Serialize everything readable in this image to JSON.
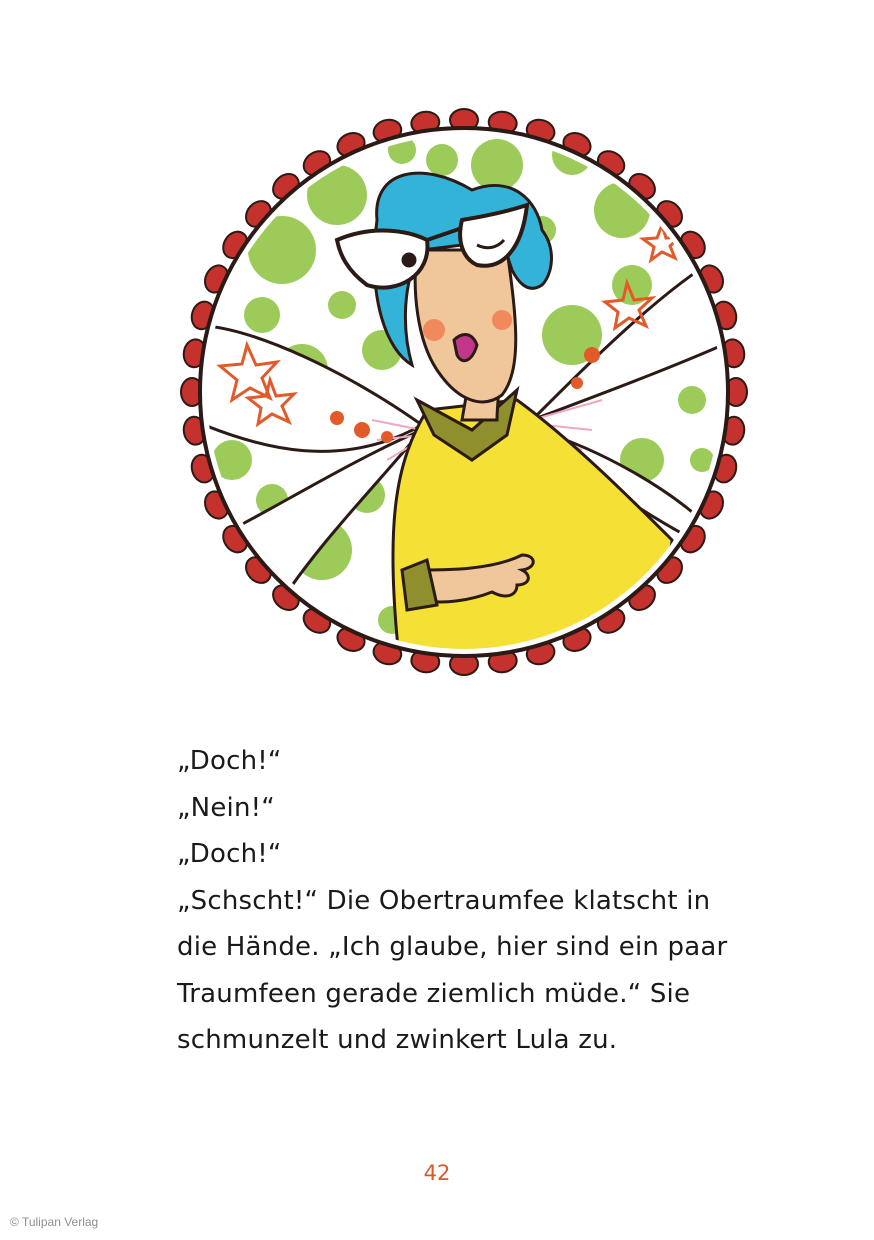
{
  "page": {
    "lines": [
      "„Doch!“",
      "„Nein!“",
      "„Doch!“",
      "„Schscht!“ Die Obertraumfee klatscht in",
      "die Hände. „Ich glaube, hier sind ein paar",
      "Traumfeen gerade ziemlich müde.“ Sie",
      "schmunzelt und zwinkert Lula zu."
    ],
    "page_number": "42",
    "copyright": "© Tulipan Verlag"
  },
  "illustration": {
    "subject": "fairy-with-glasses",
    "colors": {
      "scallop": "#c5312c",
      "dots": "#9ccb5a",
      "hair": "#34b3d8",
      "dress": "#f5e136",
      "collar": "#8f8f2e",
      "skin": "#f0c79a",
      "stars": "#e35a2a",
      "wing_veins": "#f0a8c2"
    }
  }
}
